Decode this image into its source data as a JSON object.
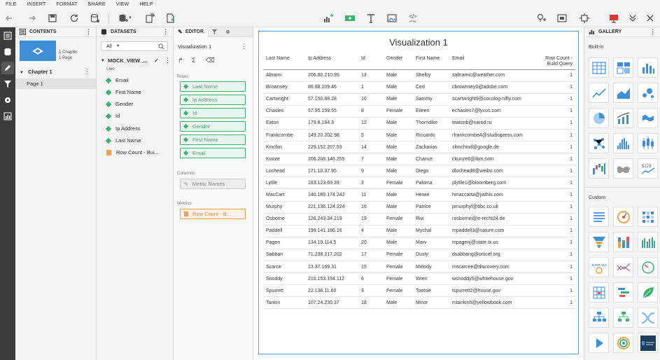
{
  "menu": [
    "FILE",
    "INSERT",
    "FORMAT",
    "SHARE",
    "VIEW",
    "HELP"
  ],
  "contents": {
    "header": "CONTENTS",
    "chapter_count": "1 Chapter",
    "page_count": "1 Page",
    "chapter": "Chapter 1",
    "page": "Page 1"
  },
  "datasets": {
    "header": "DATASETS",
    "filter": "All",
    "dataset_name": "MOCK_VIEW_...",
    "status": "Live",
    "fields": [
      "Email",
      "First Name",
      "Gender",
      "Id",
      "Ip Address",
      "Last Name",
      "Row Count - Bui..."
    ]
  },
  "editor": {
    "tab": "EDITOR",
    "viz_name": "Visualization 1",
    "rows_label": "Rows",
    "rows": [
      "Last Name",
      "Ip Address",
      "Id",
      "Gender",
      "First Name",
      "Email"
    ],
    "columns_label": "Columns",
    "columns_placeholder": "Metric Names",
    "metrics_label": "Metrics",
    "metric": "Row Count - B..."
  },
  "viz": {
    "title": "Visualization 1",
    "columns": [
      "Last Name",
      "Ip Address",
      "Id",
      "Gender",
      "First Name",
      "Email",
      "Row Count - Build Query"
    ],
    "rows": [
      [
        "Abrami",
        "206.80.210.95",
        "13",
        "Male",
        "Shelby",
        "sabramic@weather.com",
        "1"
      ],
      [
        "Brownsey",
        "86.68.109.46",
        "1",
        "Male",
        "Ced",
        "cbrownsey0@adobe.com",
        "1"
      ],
      [
        "Cartwright",
        "57.150.88.28",
        "10",
        "Male",
        "Sammy",
        "scartwright9@cocolog-nifty.com",
        "1"
      ],
      [
        "Chasles",
        "57.95.159.55",
        "8",
        "Female",
        "Eileen",
        "echasles7@lycos.com",
        "1"
      ],
      [
        "Eaton",
        "179.8.164.3",
        "12",
        "Male",
        "Thorndike",
        "teatonb@narod.ru",
        "1"
      ],
      [
        "Frankcombe",
        "149.20.202.98",
        "5",
        "Male",
        "Riccardo",
        "rfrankcombe4@studiopress.com",
        "1"
      ],
      [
        "Kinchin",
        "229.152.207.53",
        "14",
        "Male",
        "Zacharias",
        "zkinchind@google.de",
        "1"
      ],
      [
        "Kunze",
        "206.208.146.255",
        "7",
        "Male",
        "Chance",
        "ckunze6@ibm.com",
        "1"
      ],
      [
        "Lochead",
        "171.10.37.95",
        "9",
        "Male",
        "Diego",
        "dlochead8@weibo.com",
        "1"
      ],
      [
        "Lytlle",
        "183.123.69.39",
        "2",
        "Female",
        "Paloma",
        "plytlle1@bloomberg.com",
        "1"
      ],
      [
        "MacCart",
        "140.189.174.242",
        "11",
        "Male",
        "Hewie",
        "hmaccarta@jiathis.com",
        "1"
      ],
      [
        "Murphy",
        "221.136.124.224",
        "16",
        "Male",
        "Patrice",
        "pmurphyf@bbc.co.uk",
        "1"
      ],
      [
        "Osborne",
        "126.243.34.219",
        "19",
        "Female",
        "Rivi",
        "rosbornei@e-recht24.de",
        "1"
      ],
      [
        "Paddell",
        "199.141.186.16",
        "4",
        "Male",
        "Mychal",
        "mpaddell3@nature.com",
        "1"
      ],
      [
        "Pagen",
        "134.19.114.5",
        "20",
        "Male",
        "Marv",
        "mpagenj@state.tx.us",
        "1"
      ],
      [
        "Sabban",
        "71.238.217.202",
        "17",
        "Female",
        "Dusty",
        "dsabbang@unicef.org",
        "1"
      ],
      [
        "Scarce",
        "13.37.169.31",
        "15",
        "Female",
        "Melody",
        "mscarcee@discovery.com",
        "1"
      ],
      [
        "Snoddy",
        "210.153.154.112",
        "6",
        "Female",
        "Wren",
        "wsnoddy5@whitehouse.gov",
        "1"
      ],
      [
        "Spurrett",
        "22.136.11.60",
        "3",
        "Female",
        "Tootsie",
        "tspurrett2@house.gov",
        "1"
      ],
      [
        "Tankin",
        "107.24.230.37",
        "18",
        "Male",
        "Minor",
        "mtankinh@yellowbook.com",
        "1"
      ]
    ]
  },
  "gallery": {
    "header": "GALLERY",
    "builtin_label": "Built-in",
    "custom_label": "Custom",
    "custom_tile_text": "$123",
    "data_clock_text": "DATA CLOCK"
  },
  "toolbar": {
    "html_label": "HTML"
  },
  "colors": {
    "accent_blue": "#3f8ed8",
    "field_green": "#3cb371",
    "metric_orange": "#f0a050",
    "rail_dark": "#3c3c3c"
  }
}
